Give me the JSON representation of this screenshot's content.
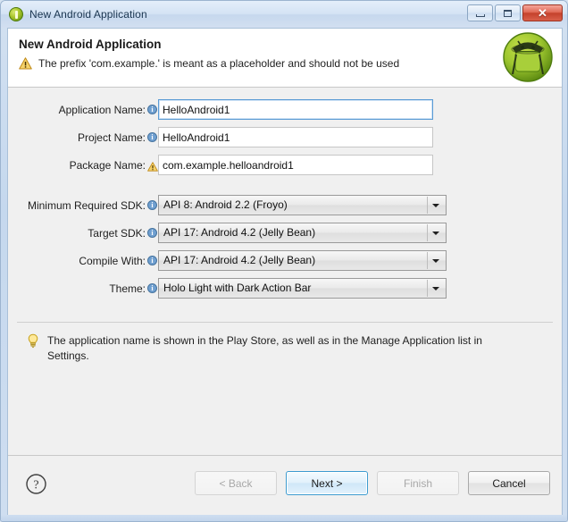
{
  "window": {
    "title": "New Android Application",
    "title_icon": "android-wizard-icon",
    "controls": {
      "minimize": "minimize-icon",
      "maximize": "maximize-icon",
      "close": "close-icon",
      "close_glyph": "✕"
    }
  },
  "header": {
    "title": "New Android Application",
    "warning_icon": "warning-triangle-icon",
    "message": "The prefix 'com.example.' is meant as a placeholder and should not be used",
    "logo_icon": "android-robot-logo"
  },
  "form": {
    "rows": [
      {
        "label": "Application Name:",
        "badge": "info",
        "type": "text",
        "value": "HelloAndroid1",
        "focused": true
      },
      {
        "label": "Project Name:",
        "badge": "info",
        "type": "text",
        "value": "HelloAndroid1",
        "focused": false
      },
      {
        "label": "Package Name:",
        "badge": "warning",
        "type": "text",
        "value": "com.example.helloandroid1",
        "focused": false
      },
      {
        "label": "Minimum Required SDK:",
        "badge": "info",
        "type": "combo",
        "value": "API 8: Android 2.2 (Froyo)"
      },
      {
        "label": "Target SDK:",
        "badge": "info",
        "type": "combo",
        "value": "API 17: Android 4.2 (Jelly Bean)"
      },
      {
        "label": "Compile With:",
        "badge": "info",
        "type": "combo",
        "value": "API 17: Android 4.2 (Jelly Bean)"
      },
      {
        "label": "Theme:",
        "badge": "info",
        "type": "combo",
        "value": "Holo Light with Dark Action Bar"
      }
    ]
  },
  "hint": {
    "icon": "lightbulb-icon",
    "text": "The application name is shown in the Play Store, as well as in the Manage Application list in Settings."
  },
  "buttons": {
    "help_icon": "help-question-icon",
    "back": "< Back",
    "next": "Next >",
    "finish": "Finish",
    "cancel": "Cancel"
  },
  "colors": {
    "accent": "#3c9bd0",
    "warning": "#f0a30a",
    "info": "#6f9fd0",
    "close": "#c4412c",
    "android_green": "#a4c639"
  }
}
